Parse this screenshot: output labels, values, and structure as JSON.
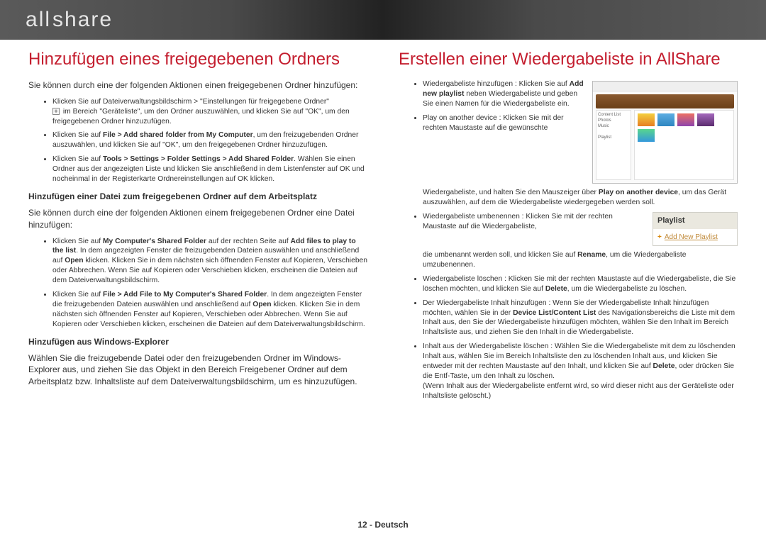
{
  "logo_text": "allshare",
  "left": {
    "title": "Hinzufügen eines freigegebenen Ordners",
    "intro": "Sie können durch eine der folgenden Aktionen einen freigegebenen Ordner hinzufügen:",
    "b1_a": "Klicken Sie auf Dateiverwaltungsbildschirm > \"Einstellungen für freigegebene Ordner\"",
    "b1_b": " im Bereich \"Geräteliste\", um den Ordner auszuwählen, und klicken Sie auf \"OK\", um den freigegebenen Ordner hinzuzufügen.",
    "b2_a": "Klicken Sie auf ",
    "b2_bold": "File > Add shared folder from My Computer",
    "b2_b": ", um den freizugebenden Ordner auszuwählen, und klicken Sie auf \"OK\", um den freigegebenen Ordner hinzuzufügen.",
    "b3_a": "Klicken Sie auf ",
    "b3_bold": "Tools > Settings > Folder Settings > Add Shared Folder",
    "b3_b": ". Wählen Sie einen Ordner aus der angezeigten Liste und klicken Sie anschließend in dem Listenfenster auf OK und nocheinmal in der Registerkarte Ordnereinstellungen auf OK klicken.",
    "sub1": "Hinzufügen einer Datei zum freigegebenen Ordner auf dem Arbeitsplatz",
    "intro2": "Sie können durch eine der folgenden Aktionen einem freigegebenen Ordner eine Datei hinzufügen:",
    "b4_a": "Klicken Sie auf ",
    "b4_bold1": "My Computer's Shared Folder",
    "b4_mid": " auf der rechten Seite auf ",
    "b4_bold2": "Add files to play to the list",
    "b4_b": ". In dem angezeigten Fenster die freizugebenden Dateien auswählen und anschließend auf ",
    "b4_bold3": "Open",
    "b4_c": " klicken. Klicken Sie in dem nächsten sich öffnenden Fenster auf Kopieren, Verschieben oder Abbrechen. Wenn Sie auf Kopieren oder Verschieben klicken, erscheinen die Dateien auf dem Dateiverwaltungsbildschirm.",
    "b5_a": "Klicken Sie auf ",
    "b5_bold": "File > Add File to My Computer's Shared Folder",
    "b5_b": ". In dem angezeigten Fenster die freizugebenden Dateien auswählen und anschließend auf ",
    "b5_bold2": "Open",
    "b5_c": " klicken. Klicken Sie in dem nächsten sich öffnenden Fenster auf Kopieren, Verschieben oder Abbrechen. Wenn Sie auf Kopieren oder Verschieben klicken, erscheinen die Dateien auf dem Dateiverwaltungsbildschirm.",
    "sub2": "Hinzufügen aus Windows-Explorer",
    "p2": "Wählen Sie die freizugebende Datei oder den freizugebenden Ordner im Windows-Explorer aus, und ziehen Sie das Objekt in den Bereich Freigebener Ordner auf dem Arbeitsplatz bzw. Inhaltsliste auf dem Dateiverwaltungsbildschirm, um es hinzuzufügen."
  },
  "right": {
    "title": "Erstellen einer Wiedergabeliste in AllShare",
    "r1_a": "Wiedergabeliste hinzufügen : Klicken Sie auf ",
    "r1_bold": "Add new playlist",
    "r1_b": " neben Wiedergabeliste und geben Sie einen Namen für die Wiedergabeliste ein.",
    "r2": "Play on another device : Klicken Sie mit der rechten Maustaste auf die gewünschte",
    "r2b_a": "Wiedergabeliste, und halten Sie den Mauszeiger über ",
    "r2b_bold": "Play on another device",
    "r2b_b": ", um das Gerät auszuwählen, auf dem die Wiedergabeliste wiedergegeben werden soll.",
    "r3_a": "Wiedergabeliste umbenennen : Klicken Sie mit der rechten Maustaste auf die Wiedergabeliste,",
    "r3b_a": "die umbenannt werden soll, und klicken Sie auf ",
    "r3b_bold": "Rename",
    "r3b_b": ", um die Wiedergabeliste umzubenennen.",
    "r4_a": "Wiedergabeliste löschen : Klicken Sie mit der rechten Maustaste auf die Wiedergabeliste, die Sie löschen möchten, und klicken Sie auf ",
    "r4_bold": "Delete",
    "r4_b": ", um die Wiedergabeliste zu löschen.",
    "r5_a": "Der Wiedergabeliste Inhalt hinzufügen : Wenn Sie der Wiedergabeliste Inhalt hinzufügen möchten, wählen Sie in der ",
    "r5_bold": "Device List/Content List",
    "r5_b": " des Navigationsbereichs die Liste mit dem Inhalt aus, den Sie der Wiedergabeliste hinzufügen möchten, wählen Sie den Inhalt im Bereich Inhaltsliste aus, und ziehen Sie den Inhalt in die Wiedergabeliste.",
    "r6_a": "Inhalt aus der Wiedergabeliste löschen : Wählen Sie die Wiedergabeliste mit dem zu löschenden Inhalt aus, wählen Sie im Bereich Inhaltsliste den zu löschenden Inhalt aus, und klicken Sie entweder mit der rechten Maustaste auf den Inhalt, und klicken Sie auf ",
    "r6_bold": "Delete",
    "r6_b": ", oder drücken Sie die Entf-Taste, um den Inhalt zu löschen.",
    "r6_c": "(Wenn Inhalt aus der Wiedergabeliste entfernt wird, so wird dieser nicht aus der Geräteliste oder Inhaltsliste gelöscht.)",
    "playlist_head": "Playlist",
    "playlist_add": "Add New Playlist"
  },
  "footer": "12 - Deutsch"
}
